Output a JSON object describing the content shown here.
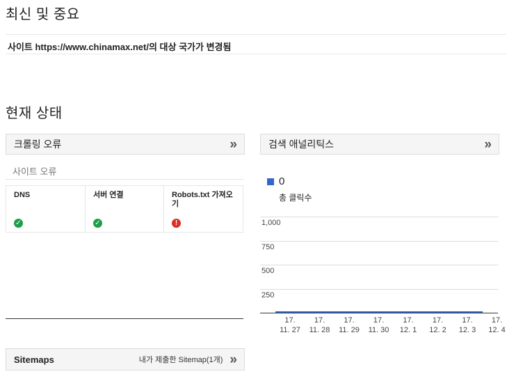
{
  "recent": {
    "title": "최신 및 중요",
    "notice": "사이트 https://www.chinamax.net/의 대상 국가가 변경됨"
  },
  "status": {
    "title": "현재 상태"
  },
  "crawl_errors": {
    "header": "크롤링 오류",
    "chevron": "»",
    "sublabel": "사이트 오류",
    "cells": [
      {
        "label": "DNS",
        "status": "ok"
      },
      {
        "label": "서버 연결",
        "status": "ok"
      },
      {
        "label": "Robots.txt 가져오기",
        "status": "error"
      }
    ]
  },
  "analytics": {
    "header": "검색 애널리틱스",
    "chevron": "»",
    "legend_value": "0",
    "legend_label": "총 클릭수"
  },
  "sitemaps": {
    "title": "Sitemaps",
    "summary": "내가 제출한 Sitemap(1개)",
    "chevron": "»"
  },
  "colors": {
    "series": "#3366cc",
    "ok": "#1e9e4a",
    "error": "#d93025"
  },
  "chart_data": {
    "type": "line",
    "title": "",
    "xlabel": "",
    "ylabel": "",
    "ylim": [
      0,
      1000
    ],
    "yticks": [
      "1,000",
      "750",
      "500",
      "250"
    ],
    "categories": [
      "17.\n11. 27",
      "17.\n11. 28",
      "17.\n11. 29",
      "17.\n11. 30",
      "17.\n12. 1",
      "17.\n12. 2",
      "17.\n12. 3",
      "17.\n12. 4"
    ],
    "series": [
      {
        "name": "총 클릭수",
        "values": [
          0,
          0,
          0,
          0,
          0,
          0,
          0,
          0
        ]
      }
    ],
    "grid": true
  }
}
